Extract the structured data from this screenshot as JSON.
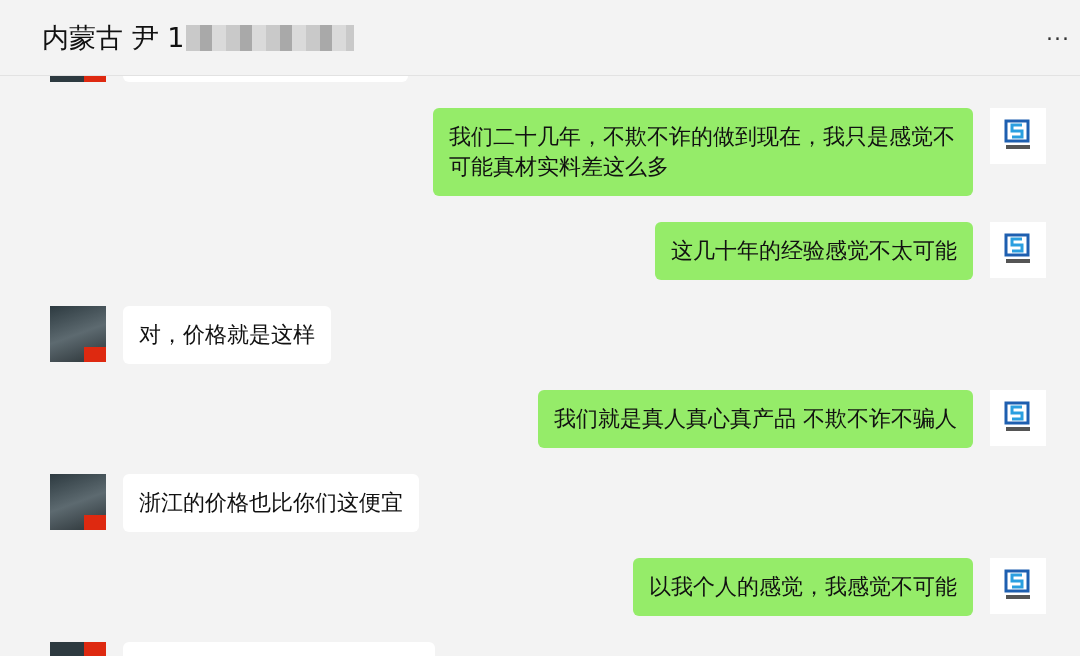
{
  "header": {
    "title": "内蒙古 尹 1",
    "more": "···"
  },
  "messages": [
    {
      "kind": "outgoing",
      "text": "我们二十几年，不欺不诈的做到现在，我只是感觉不可能真材实料差这么多"
    },
    {
      "kind": "outgoing",
      "text": "这几十年的经验感觉不太可能"
    },
    {
      "kind": "incoming",
      "text": "对，价格就是这样"
    },
    {
      "kind": "outgoing",
      "text": "我们就是真人真心真产品 不欺不诈不骗人"
    },
    {
      "kind": "incoming",
      "text": "浙江的价格也比你们这便宜"
    },
    {
      "kind": "outgoing",
      "text": "以我个人的感觉，我感觉不可能"
    }
  ]
}
